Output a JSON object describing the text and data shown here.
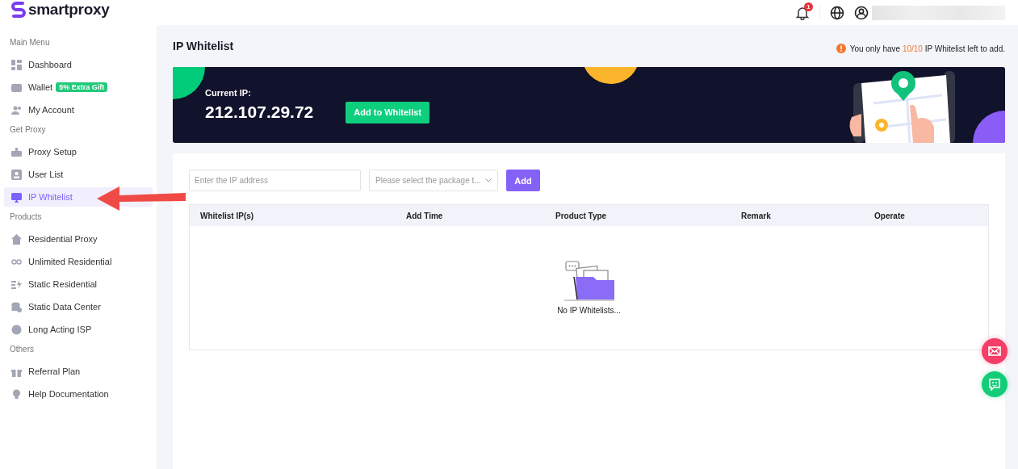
{
  "brand": "smartproxy",
  "header": {
    "notifications": "1"
  },
  "sidebar": {
    "sections": [
      {
        "title": "Main Menu",
        "items": [
          {
            "label": "Dashboard",
            "selected": false
          },
          {
            "label": "Wallet",
            "selected": false,
            "badge": "5% Extra Gift"
          },
          {
            "label": "My Account",
            "selected": false
          }
        ]
      },
      {
        "title": "Get Proxy",
        "items": [
          {
            "label": "Proxy Setup",
            "selected": false
          },
          {
            "label": "User List",
            "selected": false
          },
          {
            "label": "IP Whitelist",
            "selected": true
          }
        ]
      },
      {
        "title": "Products",
        "items": [
          {
            "label": "Residential Proxy",
            "selected": false
          },
          {
            "label": "Unlimited Residential",
            "selected": false
          },
          {
            "label": "Static Residential",
            "selected": false
          },
          {
            "label": "Static Data Center",
            "selected": false
          },
          {
            "label": "Long Acting ISP",
            "selected": false
          }
        ]
      },
      {
        "title": "Others",
        "items": [
          {
            "label": "Referral Plan",
            "selected": false
          },
          {
            "label": "Help Documentation",
            "selected": false
          }
        ]
      }
    ]
  },
  "page": {
    "title": "IP Whitelist",
    "notice": {
      "before": "You only have",
      "count": "10/10",
      "after": "IP Whitelist left to add."
    }
  },
  "banner": {
    "label": "Current IP:",
    "ip": "212.107.29.72",
    "button": "Add to Whitelist"
  },
  "form": {
    "ip_placeholder": "Enter the IP address",
    "package_placeholder": "Please select the package t...",
    "button": "Add"
  },
  "table": {
    "columns": [
      "Whitelist IP(s)",
      "Add Time",
      "Product Type",
      "Remark",
      "Operate"
    ],
    "empty": "No IP Whitelists..."
  }
}
